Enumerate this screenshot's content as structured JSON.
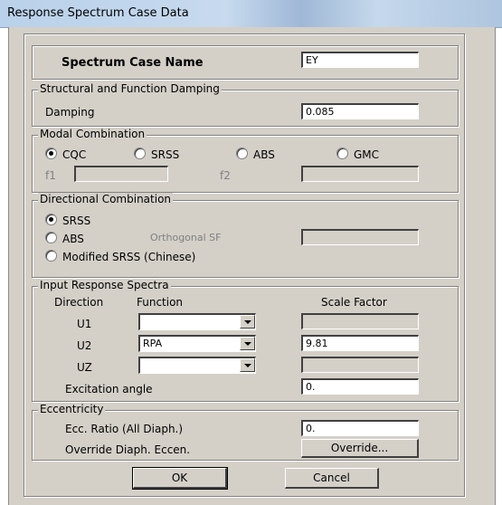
{
  "window": {
    "title": "Response Spectrum Case Data"
  },
  "spectrum_case": {
    "label": "Spectrum Case Name",
    "value": "EY"
  },
  "damping": {
    "group_label": "Structural and Function Damping",
    "label": "Damping",
    "value": "0.085"
  },
  "modal": {
    "group_label": "Modal Combination",
    "options": [
      "CQC",
      "SRSS",
      "ABS",
      "GMC"
    ],
    "selected": "CQC",
    "f1_label": "f1",
    "f2_label": "f2"
  },
  "directional": {
    "group_label": "Directional Combination",
    "options": [
      "SRSS",
      "ABS",
      "Modified SRSS (Chinese)"
    ],
    "selected": "SRSS",
    "orthogonal_label": "Orthogonal SF"
  },
  "spectra": {
    "group_label": "Input Response Spectra",
    "headers": {
      "direction": "Direction",
      "function": "Function",
      "scale": "Scale Factor"
    },
    "rows": [
      {
        "direction": "U1",
        "function": "",
        "scale": ""
      },
      {
        "direction": "U2",
        "function": "RPA",
        "scale": "9.81"
      },
      {
        "direction": "UZ",
        "function": "",
        "scale": ""
      }
    ],
    "excitation_label": "Excitation  angle",
    "excitation_value": "0."
  },
  "eccentricity": {
    "group_label": "Eccentricity",
    "ratio_label": "Ecc. Ratio (All Diaph.)",
    "ratio_value": "0.",
    "override_label": "Override Diaph. Eccen.",
    "override_button": "Override..."
  },
  "buttons": {
    "ok": "OK",
    "cancel": "Cancel"
  }
}
